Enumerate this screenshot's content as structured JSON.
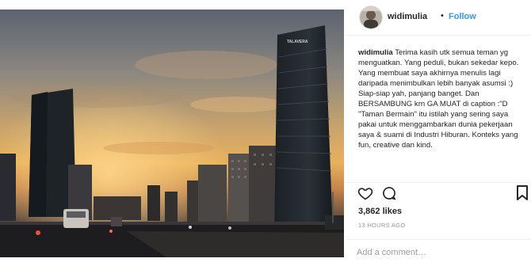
{
  "post": {
    "username": "widimulia",
    "dot": "•",
    "follow_label": "Follow",
    "caption": {
      "username": "widimulia",
      "paragraphs": [
        " Terima kasih utk semua teman yg menguatkan. Yang peduli, bukan sekedar kepo.",
        "Yang membuat saya akhirnya menulis lagi daripada menimbulkan lebih banyak asumsi :) Siap-siap yah, panjang banget. Dan BERSAMBUNG krn GA MUAT di caption :\"D \"Taman Bermain\" itu istilah yang sering saya pakai untuk menggambarkan dunia pekerjaan saya & suami di Industri Hiburan. Konteks yang fun, creative dan kind."
      ]
    },
    "likes": "3,862 likes",
    "time": "13 HOURS AGO",
    "comment_placeholder": "Add a comment…"
  },
  "photo": {
    "building_sign": "TALAVERA"
  },
  "colors": {
    "follow": "#3897f0",
    "text": "#262626",
    "muted": "#999999"
  },
  "icons": [
    "heart-icon",
    "comment-icon",
    "bookmark-icon"
  ]
}
